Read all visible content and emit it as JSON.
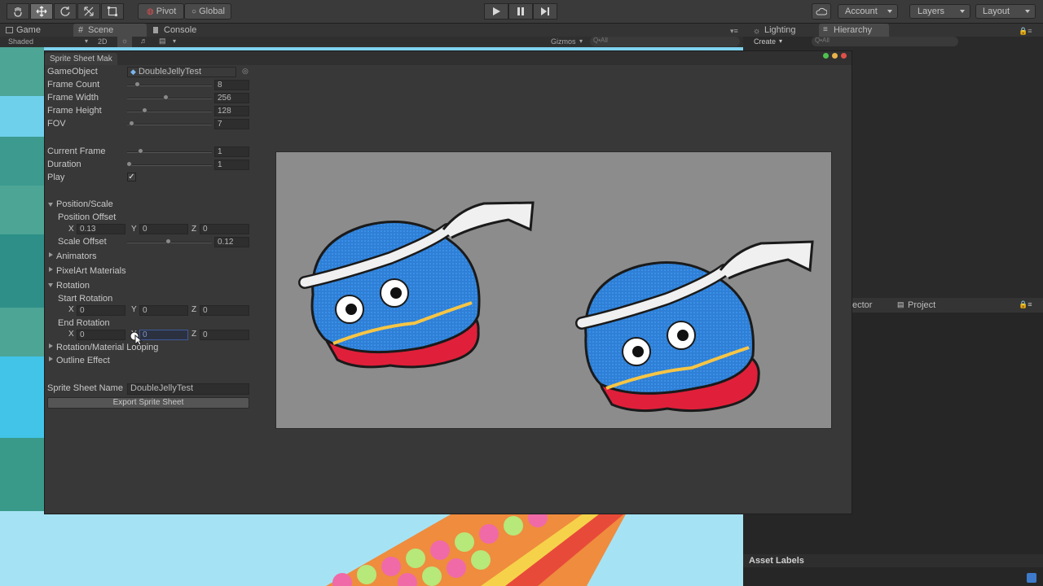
{
  "toolbar": {
    "pivot_label": "Pivot",
    "global_label": "Global",
    "account_label": "Account",
    "layers_label": "Layers",
    "layout_label": "Layout"
  },
  "tabs": {
    "game": "Game",
    "scene": "Scene",
    "console": "Console",
    "lighting": "Lighting",
    "hierarchy": "Hierarchy",
    "inspector_partial": "ector",
    "project": "Project"
  },
  "scene_bar": {
    "shaded": "Shaded",
    "mode_2d": "2D",
    "gizmos": "Gizmos",
    "search_placeholder": "Q•All"
  },
  "hierarchy_bar": {
    "create": "Create",
    "search_placeholder": "Q•All"
  },
  "window": {
    "title": "Sprite Sheet Mak",
    "fields": {
      "gameobject_label": "GameObject",
      "gameobject_value": "DoubleJellyTest",
      "frame_count_label": "Frame Count",
      "frame_count_value": "8",
      "frame_width_label": "Frame Width",
      "frame_width_value": "256",
      "frame_height_label": "Frame Height",
      "frame_height_value": "128",
      "fov_label": "FOV",
      "fov_value": "7",
      "current_frame_label": "Current Frame",
      "current_frame_value": "1",
      "duration_label": "Duration",
      "duration_value": "1",
      "play_label": "Play",
      "play_checked": "✓"
    },
    "sections": {
      "position_scale": "Position/Scale",
      "position_offset": "Position Offset",
      "scale_offset": "Scale Offset",
      "scale_offset_value": "0.12",
      "animators": "Animators",
      "pixelart_materials": "PixelArt Materials",
      "rotation": "Rotation",
      "start_rotation": "Start Rotation",
      "end_rotation": "End Rotation",
      "rotation_material_looping": "Rotation/Material Looping",
      "outline_effect": "Outline Effect"
    },
    "vectors": {
      "x_label": "X",
      "y_label": "Y",
      "z_label": "Z",
      "pos_x": "0.13",
      "pos_y": "0",
      "pos_z": "0",
      "start_x": "0",
      "start_y": "0",
      "start_z": "0",
      "end_x": "0",
      "end_y": "0",
      "end_z": "0"
    },
    "sprite_sheet_name_label": "Sprite Sheet Name",
    "sprite_sheet_name_value": "DoubleJellyTest",
    "export_button": "Export Sprite Sheet"
  },
  "inspector": {
    "asset_labels": "Asset Labels"
  },
  "colors": {
    "accent_selected": "#3d5a98",
    "jelly_blue": "#2f7fd6",
    "jelly_red": "#e0203a",
    "preview_bg": "#8c8c8c"
  }
}
